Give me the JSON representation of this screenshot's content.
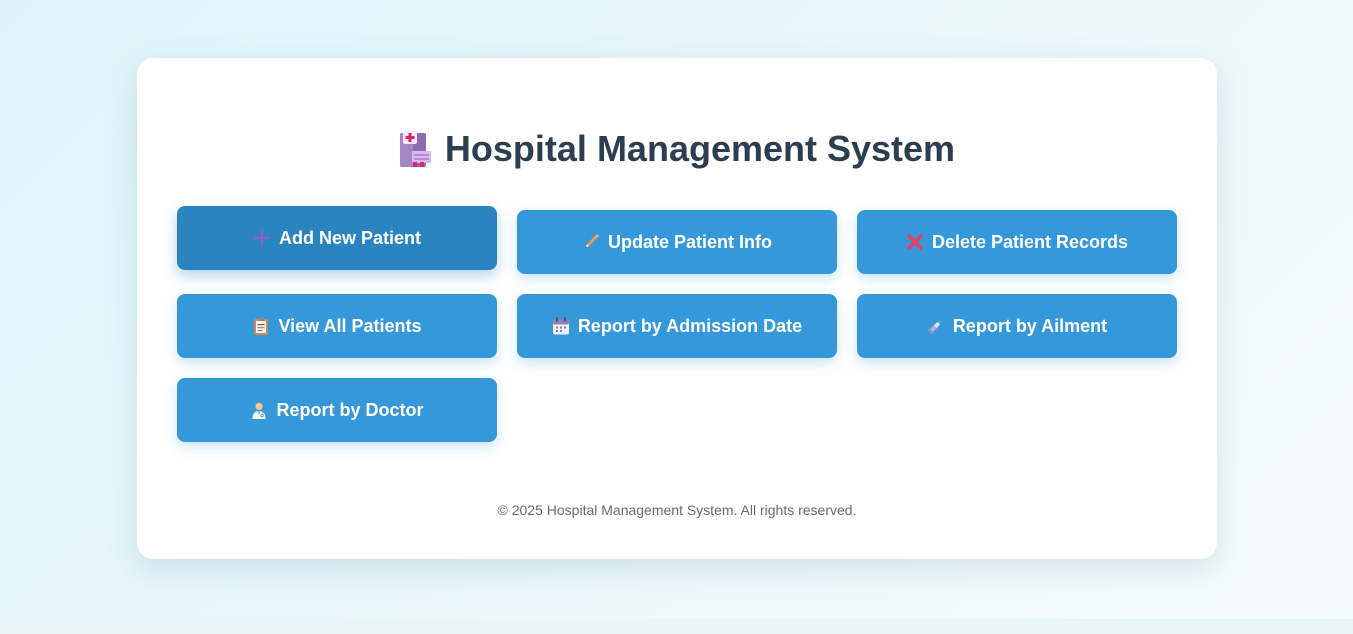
{
  "header": {
    "title": "Hospital Management System",
    "icon": "hospital-icon"
  },
  "menu": {
    "items": [
      {
        "label": "Add New Patient",
        "icon": "plus-icon",
        "state": "active"
      },
      {
        "label": "Update Patient Info",
        "icon": "pencil-icon"
      },
      {
        "label": "Delete Patient Records",
        "icon": "cross-icon"
      },
      {
        "label": "View All Patients",
        "icon": "clipboard-icon"
      },
      {
        "label": "Report by Admission Date",
        "icon": "calendar-icon"
      },
      {
        "label": "Report by Ailment",
        "icon": "syringe-icon"
      },
      {
        "label": "Report by Doctor",
        "icon": "doctor-icon"
      }
    ]
  },
  "footer": {
    "text": "© 2025 Hospital Management System. All rights reserved."
  },
  "colors": {
    "button": "#3598db",
    "button_active": "#2a84bf",
    "title": "#2c3e50"
  }
}
